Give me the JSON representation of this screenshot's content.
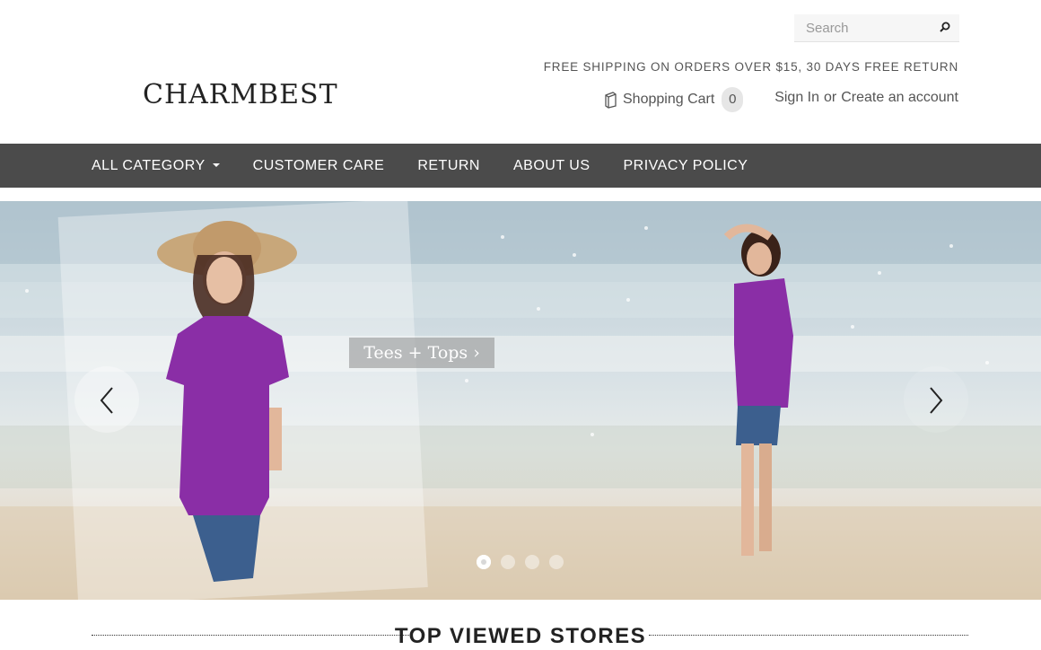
{
  "header": {
    "search_placeholder": "Search",
    "logo_text": "CHARMBEST",
    "promo": "FREE SHIPPING ON ORDERS OVER $15, 30 DAYS FREE RETURN",
    "cart_label": "Shopping Cart",
    "cart_count": "0",
    "sign_in": "Sign In",
    "or_text": "or",
    "create_account": "Create an account"
  },
  "nav": {
    "items": [
      {
        "label": "ALL CATEGORY",
        "dropdown": true
      },
      {
        "label": "CUSTOMER CARE"
      },
      {
        "label": "RETURN"
      },
      {
        "label": "ABOUT US"
      },
      {
        "label": "PRIVACY POLICY"
      }
    ]
  },
  "hero": {
    "cta": "Tees + Tops ›",
    "slides": 4,
    "active_slide": 1
  },
  "section": {
    "title": "TOP VIEWED STORES"
  },
  "colors": {
    "nav_bg": "#4b4b4b",
    "accent_top": "#8a2ea6"
  }
}
